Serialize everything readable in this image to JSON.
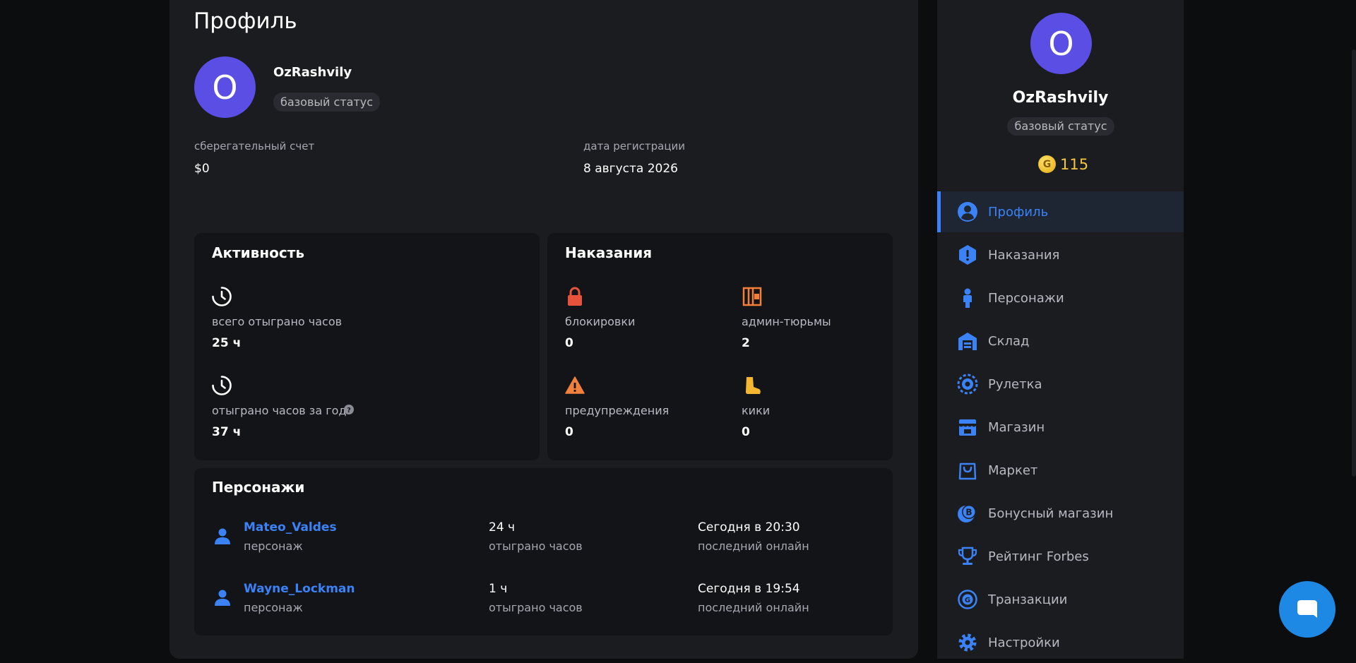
{
  "profile": {
    "title": "Профиль",
    "avatar_letter": "O",
    "username": "OzRashvily",
    "status": "базовый статус",
    "savings_label": "сберегательный счет",
    "savings_value": "$0",
    "reg_label": "дата регистрации",
    "reg_value": "8 августа 2026"
  },
  "activity": {
    "title": "Активность",
    "total_hours_label": "всего отыграно часов",
    "total_hours_value": "25 ч",
    "year_hours_label": "отыграно часов за год",
    "year_hours_value": "37 ч"
  },
  "punishments": {
    "title": "Наказания",
    "bans_label": "блокировки",
    "bans_value": "0",
    "jails_label": "админ-тюрьмы",
    "jails_value": "2",
    "warnings_label": "предупреждения",
    "warnings_value": "0",
    "kicks_label": "кики",
    "kicks_value": "0"
  },
  "characters": {
    "title": "Персонажи",
    "list": [
      {
        "name": "Mateo_Valdes",
        "role": "персонаж",
        "hours": "24 ч",
        "hours_label": "отыграно часов",
        "last_online": "Сегодня в 20:30",
        "last_online_label": "последний онлайн"
      },
      {
        "name": "Wayne_Lockman",
        "role": "персонаж",
        "hours": "1 ч",
        "hours_label": "отыграно часов",
        "last_online": "Сегодня в 19:54",
        "last_online_label": "последний онлайн"
      }
    ]
  },
  "sidebar": {
    "avatar_letter": "O",
    "username": "OzRashvily",
    "status": "базовый статус",
    "coin_letter": "G",
    "coins": "115",
    "items": [
      {
        "label": "Профиль",
        "icon": "user-circle-icon"
      },
      {
        "label": "Наказания",
        "icon": "alert-hexagon-icon"
      },
      {
        "label": "Персонажи",
        "icon": "person-icon"
      },
      {
        "label": "Склад",
        "icon": "warehouse-icon"
      },
      {
        "label": "Рулетка",
        "icon": "roulette-icon"
      },
      {
        "label": "Магазин",
        "icon": "store-icon"
      },
      {
        "label": "Маркет",
        "icon": "shopping-bag-icon"
      },
      {
        "label": "Бонусный магазин",
        "icon": "bonus-coin-icon"
      },
      {
        "label": "Рейтинг Forbes",
        "icon": "trophy-icon"
      },
      {
        "label": "Транзакции",
        "icon": "transactions-icon"
      },
      {
        "label": "Настройки",
        "icon": "gear-icon"
      }
    ]
  },
  "colors": {
    "accent": "#3b82f6",
    "avatar": "#5b4ee4",
    "danger": "#e5533d",
    "warning": "#f0803c",
    "coin": "#f6c540"
  }
}
